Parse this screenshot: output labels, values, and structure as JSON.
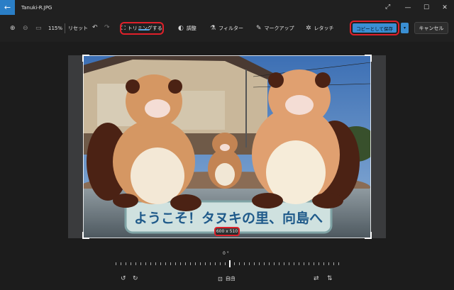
{
  "window": {
    "title": "Tanuki-R.JPG",
    "back_icon": "back-arrow-icon"
  },
  "toolbar": {
    "zoom_level": "115%",
    "reset_label": "リセット",
    "crop_label": "トリミングする",
    "adjust_label": "調整",
    "filter_label": "フィルター",
    "markup_label": "マークアップ",
    "retouch_label": "レタッチ",
    "save_copy_label": "コピーとして保存",
    "cancel_label": "キャンセル"
  },
  "crop": {
    "size_text": "600 x 510"
  },
  "rotation": {
    "angle_text": "0 °",
    "aspect_label": "自由"
  },
  "colors": {
    "accent": "#3a8fd4",
    "highlight": "#e0202a",
    "background": "#1c1c1c"
  }
}
